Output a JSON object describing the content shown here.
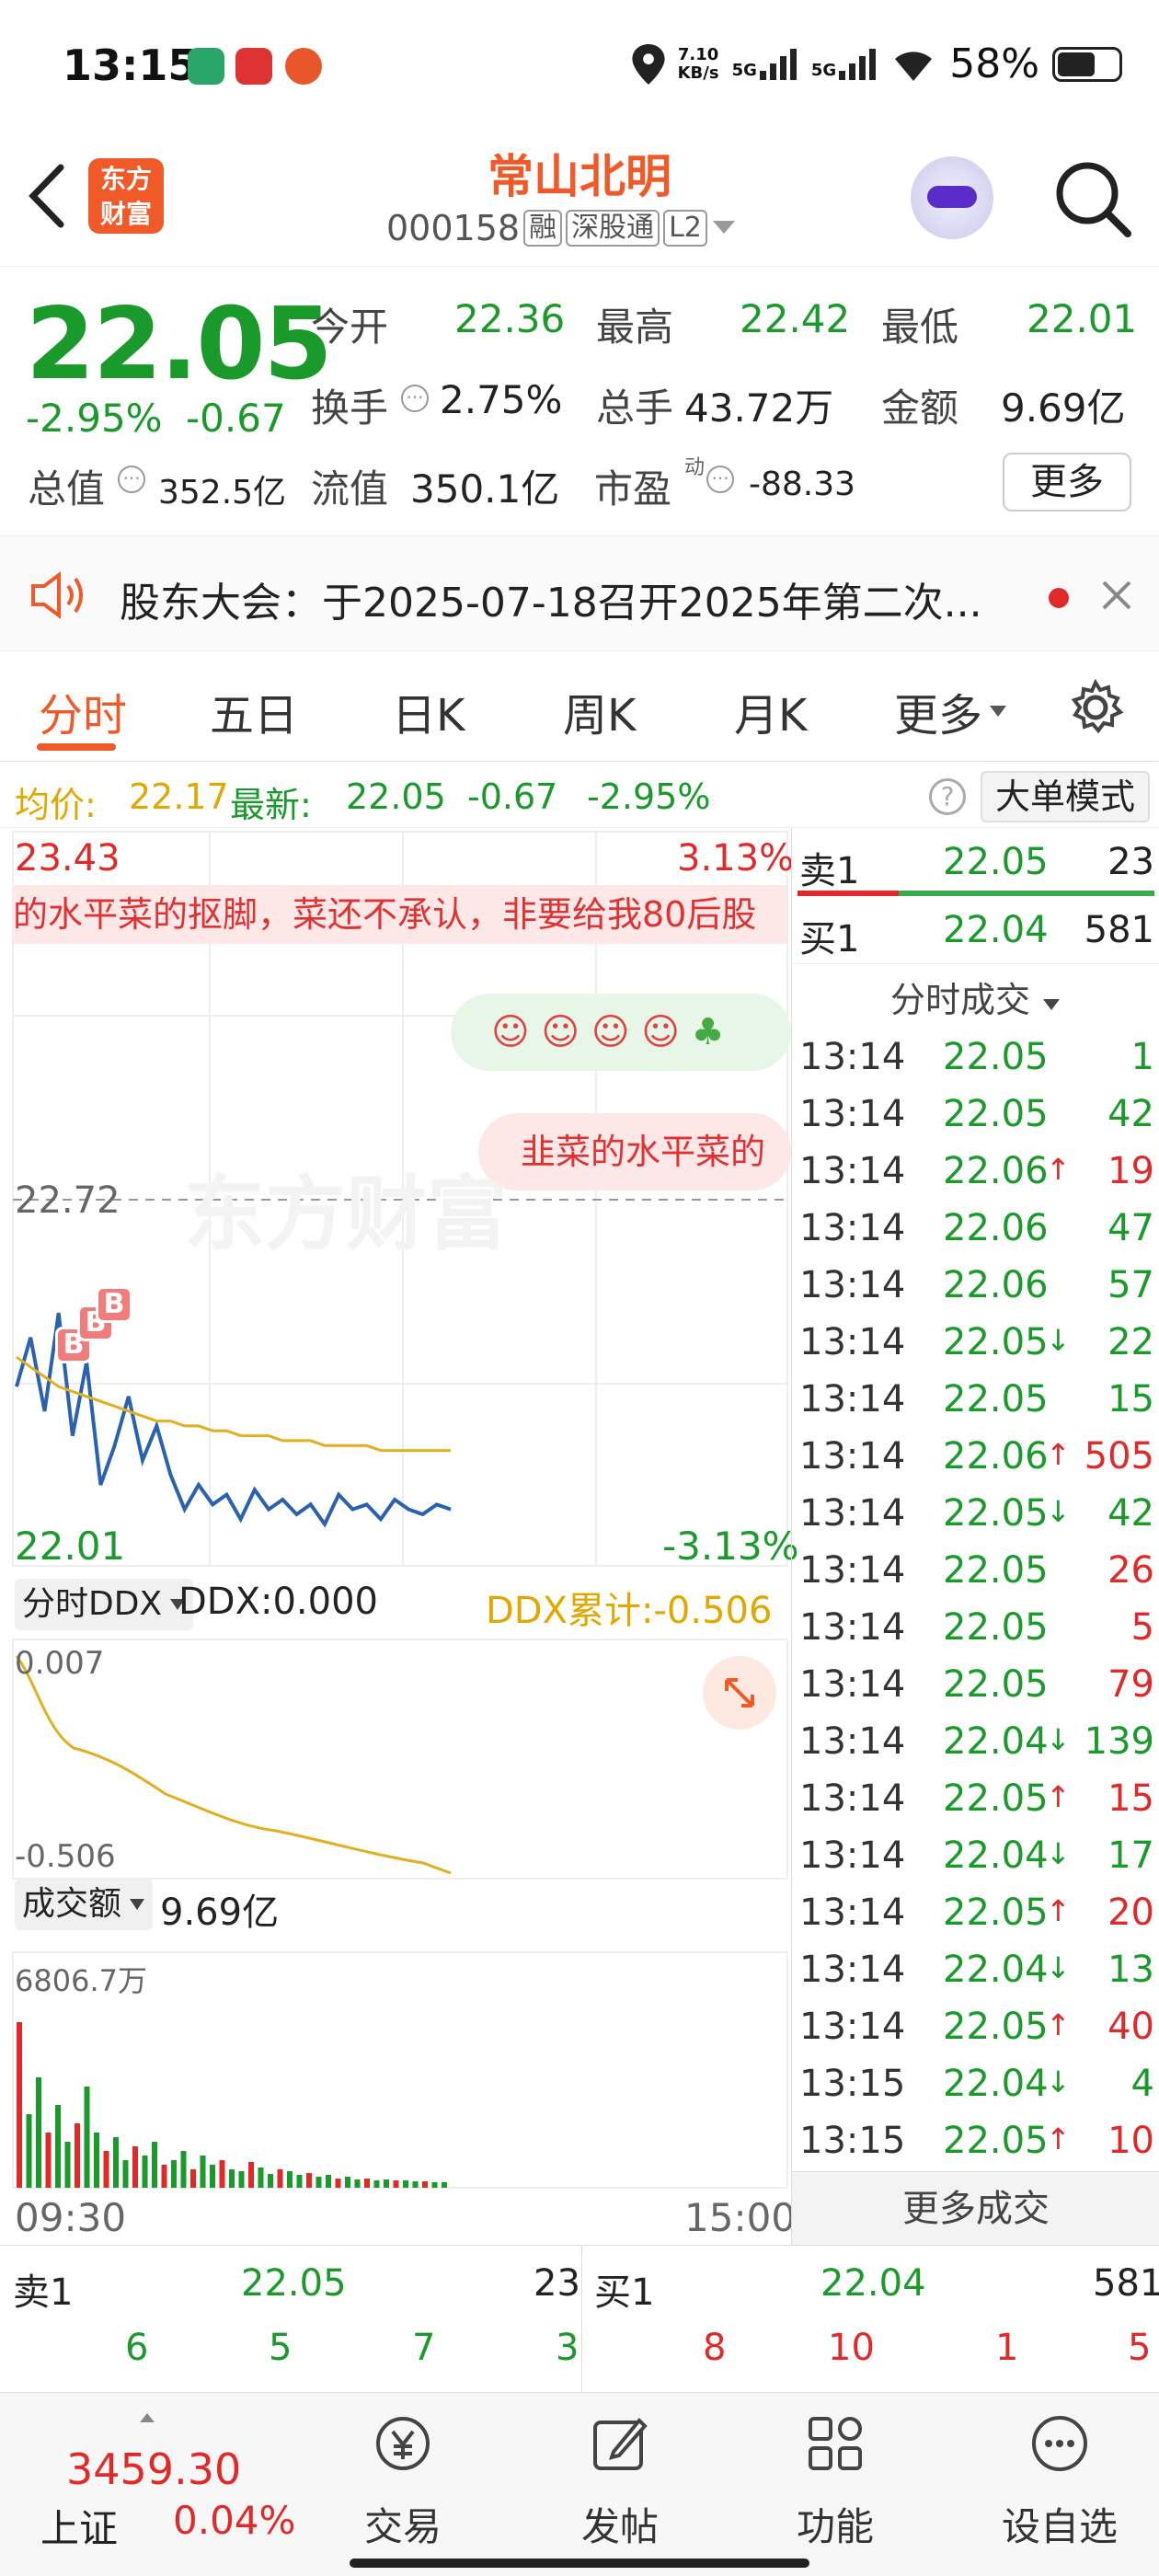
{
  "status_bar": {
    "time": "13:15",
    "net_speed_top": "7.10",
    "net_speed_bottom": "KB/s",
    "signal1": "5G",
    "signal2": "5G",
    "battery": "58%"
  },
  "header": {
    "logo_line1": "东方",
    "logo_line2": "财富",
    "name": "常山北明",
    "code": "000158",
    "tags": [
      "融",
      "深股通",
      "L2"
    ]
  },
  "quote": {
    "price": "22.05",
    "change_pct": "-2.95%",
    "change": "-0.67",
    "open_label": "今开",
    "open": "22.36",
    "high_label": "最高",
    "high": "22.42",
    "low_label": "最低",
    "low": "22.01",
    "turnover_label": "换手",
    "turnover": "2.75%",
    "volume_label": "总手",
    "volume": "43.72万",
    "amount_label": "金额",
    "amount": "9.69亿",
    "mktcap_label": "总值",
    "mktcap": "352.5亿",
    "float_label": "流值",
    "float": "350.1亿",
    "pe_label": "市盈",
    "pe_sup": "动",
    "pe": "-88.33",
    "more": "更多"
  },
  "notice": {
    "text": "股东大会：于2025-07-18召开2025年第二次..."
  },
  "tabs": [
    "分时",
    "五日",
    "日K",
    "周K",
    "月K",
    "更多"
  ],
  "avgbar": {
    "avg_label": "均价:",
    "avg": "22.17",
    "latest_label": "最新:",
    "latest": "22.05",
    "change": "-0.67",
    "change_pct": "-2.95%",
    "mode": "大单模式"
  },
  "chart": {
    "top_price": "23.43",
    "top_pct": "3.13%",
    "mid_price": "22.72",
    "bottom_price": "22.01",
    "bottom_pct": "-3.13%",
    "danmaku1": "的水平菜的抠脚，菜还不承认，非要给我80后股",
    "danmaku2": "韭菜的水平菜的",
    "watermark": "东方财富",
    "ddx_select": "分时DDX",
    "ddx": "DDX:0.000",
    "ddx_cum": "DDX累计:-0.506",
    "ddx_top": "0.007",
    "ddx_bottom": "-0.506",
    "vol_select": "成交额",
    "vol_total": "9.69亿",
    "vol_max": "6806.7万",
    "time_start": "09:30",
    "time_end": "15:00",
    "markers": [
      "B",
      "B",
      "B"
    ]
  },
  "chart_data": {
    "type": "line",
    "series": [
      {
        "values": [
          22.3,
          22.4,
          22.25,
          22.45,
          22.2,
          22.35,
          22.1,
          22.18,
          22.28,
          22.15,
          22.22,
          22.12,
          22.05,
          22.1,
          22.06,
          22.08,
          22.03,
          22.09,
          22.05,
          22.07,
          22.04,
          22.06,
          22.02,
          22.08,
          22.05,
          22.06,
          22.03,
          22.07,
          22.05,
          22.04,
          22.06,
          22.05
        ]
      },
      {
        "values": [
          22.36,
          22.34,
          22.32,
          22.3,
          22.29,
          22.28,
          22.27,
          22.26,
          22.25,
          22.24,
          22.23,
          22.23,
          22.22,
          22.22,
          22.21,
          22.21,
          22.2,
          22.2,
          22.2,
          22.19,
          22.19,
          22.19,
          22.18,
          22.18,
          22.18,
          22.18,
          22.17,
          22.17,
          22.17,
          22.17,
          22.17,
          22.17
        ]
      }
    ],
    "ylim": [
      22.01,
      23.43
    ],
    "x_ticks": [
      "09:30",
      "15:00"
    ]
  },
  "trades": {
    "bid_ask": [
      {
        "label": "卖1",
        "price": "22.05",
        "vol": "23"
      },
      {
        "label": "买1",
        "price": "22.04",
        "vol": "581"
      }
    ],
    "header": "分时成交",
    "rows": [
      {
        "t": "13:14",
        "p": "22.05",
        "a": "",
        "v": "1",
        "c": "green"
      },
      {
        "t": "13:14",
        "p": "22.05",
        "a": "",
        "v": "42",
        "c": "green"
      },
      {
        "t": "13:14",
        "p": "22.06",
        "a": "↑",
        "v": "19",
        "c": "red"
      },
      {
        "t": "13:14",
        "p": "22.06",
        "a": "",
        "v": "47",
        "c": "green"
      },
      {
        "t": "13:14",
        "p": "22.06",
        "a": "",
        "v": "57",
        "c": "green"
      },
      {
        "t": "13:14",
        "p": "22.05",
        "a": "↓",
        "v": "22",
        "c": "green"
      },
      {
        "t": "13:14",
        "p": "22.05",
        "a": "",
        "v": "15",
        "c": "green"
      },
      {
        "t": "13:14",
        "p": "22.06",
        "a": "↑",
        "v": "505",
        "c": "red"
      },
      {
        "t": "13:14",
        "p": "22.05",
        "a": "↓",
        "v": "42",
        "c": "green"
      },
      {
        "t": "13:14",
        "p": "22.05",
        "a": "",
        "v": "26",
        "c": "red"
      },
      {
        "t": "13:14",
        "p": "22.05",
        "a": "",
        "v": "5",
        "c": "red"
      },
      {
        "t": "13:14",
        "p": "22.05",
        "a": "",
        "v": "79",
        "c": "red"
      },
      {
        "t": "13:14",
        "p": "22.04",
        "a": "↓",
        "v": "139",
        "c": "green"
      },
      {
        "t": "13:14",
        "p": "22.05",
        "a": "↑",
        "v": "15",
        "c": "red"
      },
      {
        "t": "13:14",
        "p": "22.04",
        "a": "↓",
        "v": "17",
        "c": "green"
      },
      {
        "t": "13:14",
        "p": "22.05",
        "a": "↑",
        "v": "20",
        "c": "red"
      },
      {
        "t": "13:14",
        "p": "22.04",
        "a": "↓",
        "v": "13",
        "c": "green"
      },
      {
        "t": "13:14",
        "p": "22.05",
        "a": "↑",
        "v": "40",
        "c": "red"
      },
      {
        "t": "13:15",
        "p": "22.04",
        "a": "↓",
        "v": "4",
        "c": "green"
      },
      {
        "t": "13:15",
        "p": "22.05",
        "a": "↑",
        "v": "10",
        "c": "red"
      }
    ],
    "more": "更多成交"
  },
  "book": {
    "sell_label": "卖1",
    "sell_price": "22.05",
    "sell_vol": "23",
    "buy_label": "买1",
    "buy_price": "22.04",
    "buy_vol": "581",
    "sell_row": [
      "6",
      "5",
      "7",
      "3"
    ],
    "buy_row": [
      "8",
      "10",
      "1",
      "5"
    ]
  },
  "nav": {
    "index_value": "3459.30",
    "index_name": "上证",
    "index_pct": "0.04%",
    "items": [
      "交易",
      "发帖",
      "功能",
      "设自选"
    ]
  },
  "colors": {
    "brand": "#f05a28",
    "up": "#e02a2a",
    "down": "#1a9a2a",
    "avg_line": "#e0a800"
  }
}
